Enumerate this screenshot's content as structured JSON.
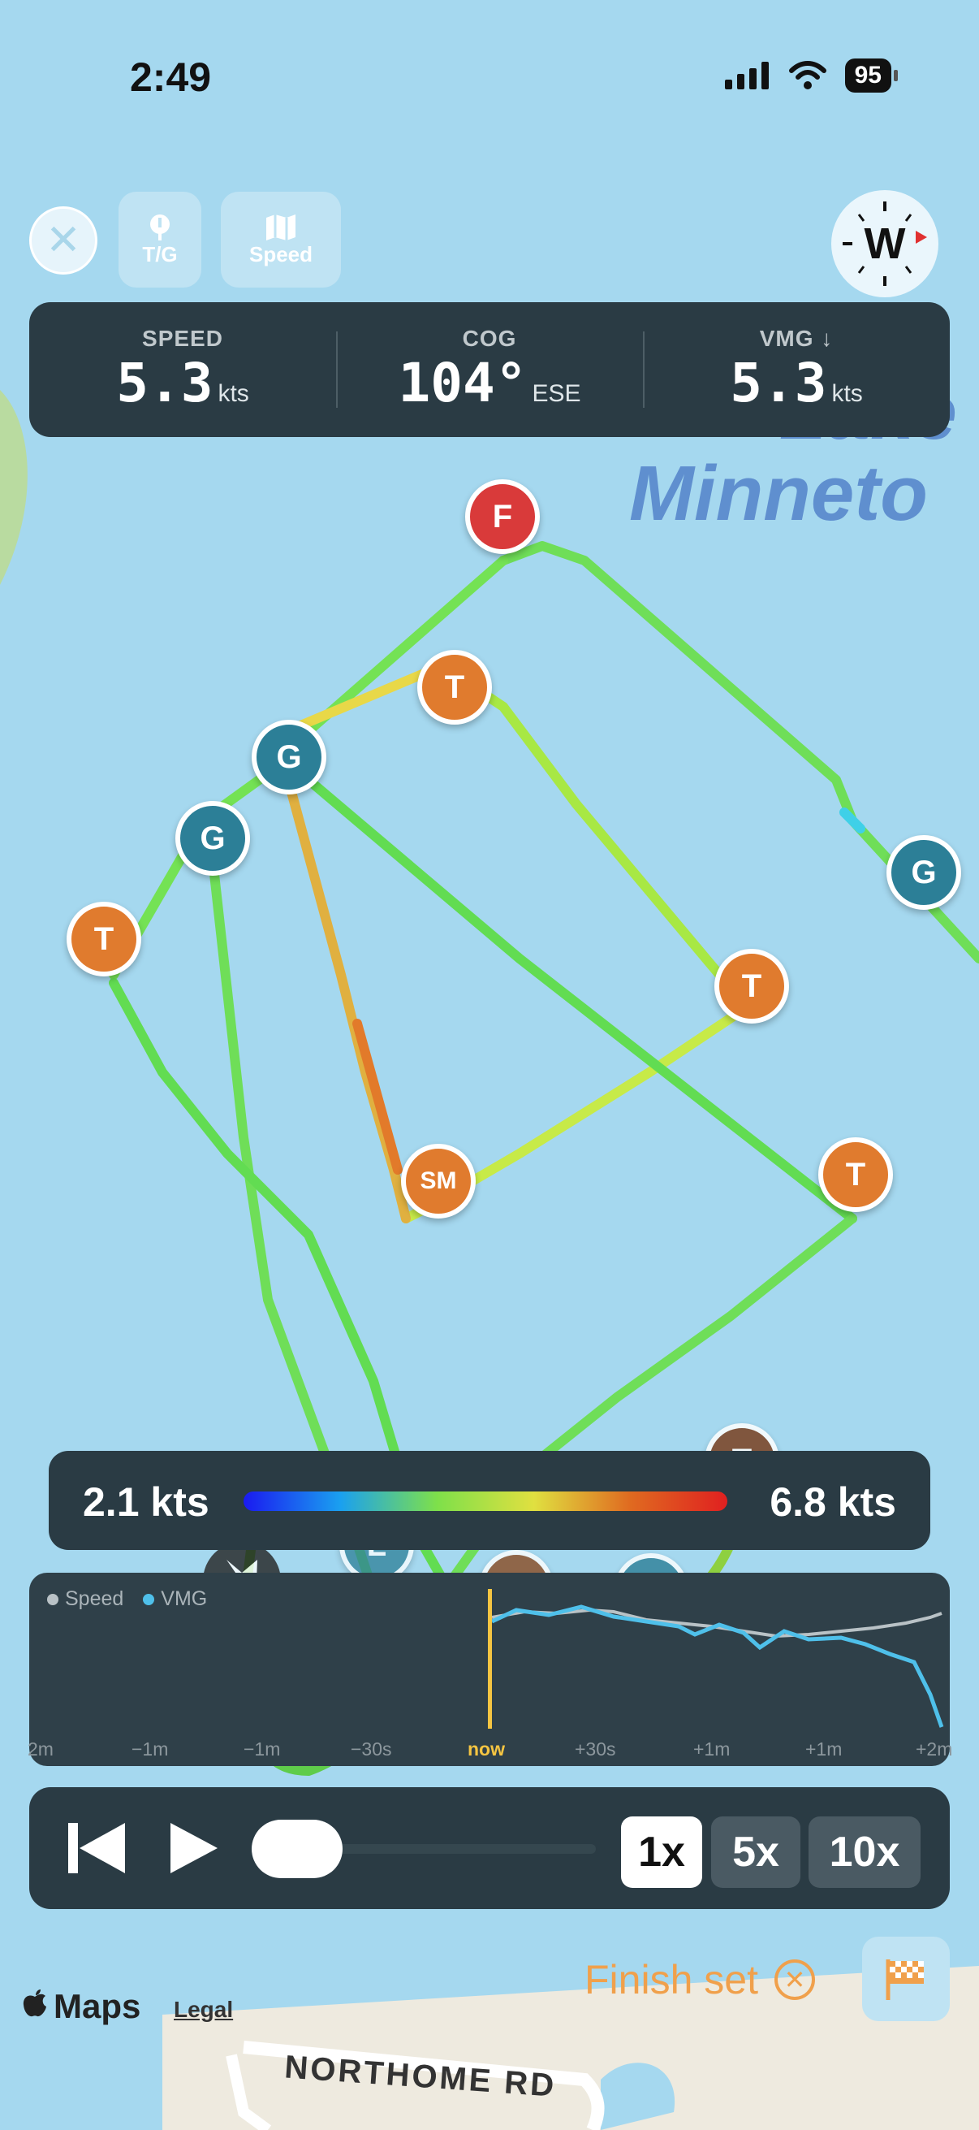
{
  "status_bar": {
    "time": "2:49",
    "battery": "95"
  },
  "toolbar": {
    "tg_label": "T/G",
    "speed_label": "Speed",
    "compass_letter": "W"
  },
  "stats": [
    {
      "label": "SPEED",
      "value": "5.3",
      "unit": "kts"
    },
    {
      "label": "COG",
      "value": "104°",
      "unit": "ESE"
    },
    {
      "label": "VMG ↓",
      "value": "5.3",
      "unit": "kts"
    }
  ],
  "map": {
    "lake_line1": "Lake",
    "lake_line2": "Minneto",
    "road_label": "NORTHOME RD",
    "attribution": "Maps",
    "legal": "Legal"
  },
  "markers": [
    {
      "label": "F",
      "kind": "finish"
    },
    {
      "label": "T",
      "kind": "tack"
    },
    {
      "label": "G",
      "kind": "gybe"
    },
    {
      "label": "G",
      "kind": "gybe"
    },
    {
      "label": "T",
      "kind": "tack"
    },
    {
      "label": "G",
      "kind": "gybe"
    },
    {
      "label": "T",
      "kind": "tack"
    },
    {
      "label": "SM",
      "kind": "mark"
    },
    {
      "label": "T",
      "kind": "tack"
    },
    {
      "label": "T",
      "kind": "tack"
    },
    {
      "label": "L",
      "kind": "gybe"
    },
    {
      "label": "T",
      "kind": "tack"
    },
    {
      "label": "G",
      "kind": "gybe"
    }
  ],
  "speed_legend": {
    "min": "2.1 kts",
    "max": "6.8 kts"
  },
  "graph": {
    "legend": [
      {
        "name": "Speed",
        "color": "#b9c2c6"
      },
      {
        "name": "VMG",
        "color": "#4fc0ea"
      }
    ],
    "ticks": [
      "2m",
      "−1m",
      "−1m",
      "−30s",
      "now",
      "+30s",
      "+1m",
      "+1m",
      "+2m"
    ]
  },
  "playback": {
    "speeds": [
      "1x",
      "5x",
      "10x"
    ],
    "selected": "1x",
    "progress": 0.12
  },
  "finish": {
    "label": "Finish set"
  },
  "colors": {
    "panel": "#2a3b44",
    "finish_orange": "#f0a04b",
    "tack": "#e07b2e",
    "gybe": "#2c7f97",
    "finish_mark": "#d93a3a"
  }
}
